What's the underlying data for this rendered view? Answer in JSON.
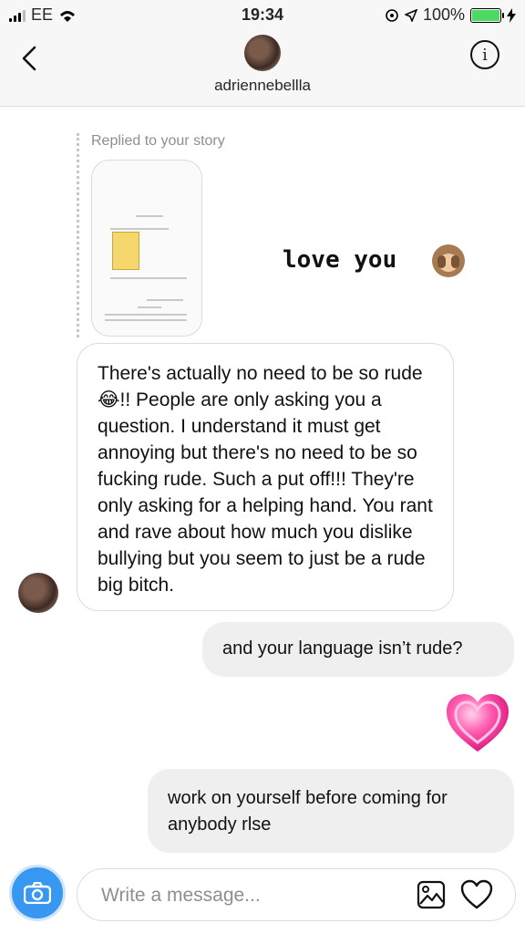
{
  "status_bar": {
    "carrier": "EE",
    "time": "19:34",
    "battery": "100%"
  },
  "header": {
    "username": "adriennebellla",
    "info_icon": "info-icon",
    "back_icon": "chevron-left-icon"
  },
  "story_reply": {
    "label": "Replied to your story",
    "caption": "love you",
    "caption_emoji": "see-no-evil-monkey"
  },
  "messages": [
    {
      "from": "them",
      "text": "There's actually no need to be so rude😂!! People are only asking you a question.  I understand it must get annoying but there's no need to be so fucking rude. Such a put off!!! They're only asking for a helping hand. You rant and rave about how much you dislike bullying but you seem to just be a rude big bitch."
    },
    {
      "from": "me",
      "text": "and your language isn’t rude?"
    },
    {
      "from": "me",
      "type": "emoji",
      "emoji": "heart"
    },
    {
      "from": "me",
      "text": "work on yourself before coming for anybody rlse"
    }
  ],
  "composer": {
    "placeholder": "Write a message...",
    "camera_icon": "camera-icon",
    "gallery_icon": "image-icon",
    "like_icon": "heart-icon"
  },
  "colors": {
    "accent": "#3897f0",
    "bubble_out": "#efefef",
    "battery": "#4cd964"
  }
}
